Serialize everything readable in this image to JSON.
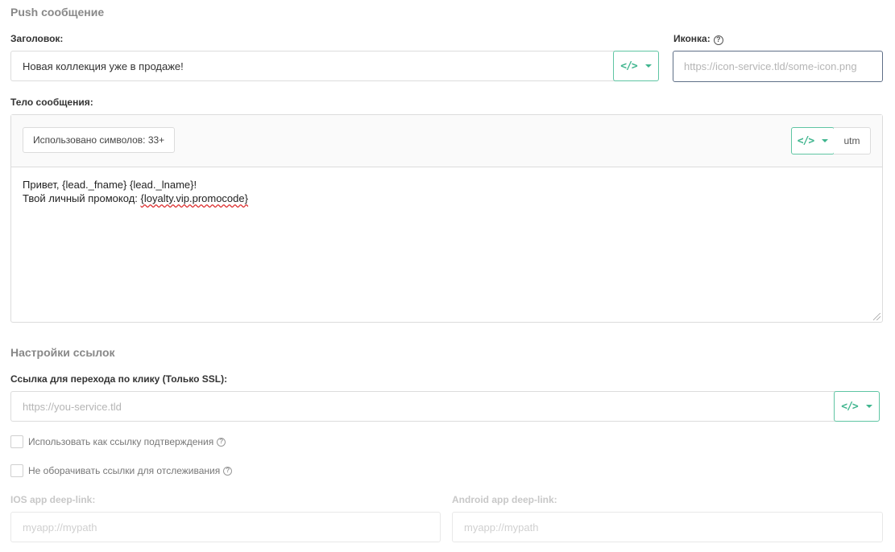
{
  "push_section": {
    "title": "Push сообщение",
    "header_label": "Заголовок:",
    "header_value": "Новая коллекция уже в продаже!",
    "icon_label": "Иконка:",
    "icon_placeholder": "https://icon-service.tld/some-icon.png",
    "body_label": "Тело сообщения:",
    "counter_text": "Использовано символов: 33+",
    "utm_label": "utm",
    "body_line1": "Привет, {lead._fname} {lead._lname}!",
    "body_line2_prefix": "Твой личный промокод: ",
    "body_line2_code": "{loyalty.vip.promocode}"
  },
  "links_section": {
    "title": "Настройки ссылок",
    "click_label": "Ссылка для перехода по клику (Только SSL):",
    "click_placeholder": "https://you-service.tld",
    "confirm_checkbox_label": "Использовать как ссылку подтверждения",
    "nowrap_checkbox_label": "Не оборачивать ссылки для отслеживания",
    "ios_label": "IOS app deep-link:",
    "ios_placeholder": "myapp://mypath",
    "android_label": "Android app deep-link:",
    "android_placeholder": "myapp://mypath"
  },
  "icons": {
    "help": "?",
    "code": "</>"
  },
  "colors": {
    "accent": "#3fb58e",
    "accent_border": "#5fc5a3"
  }
}
